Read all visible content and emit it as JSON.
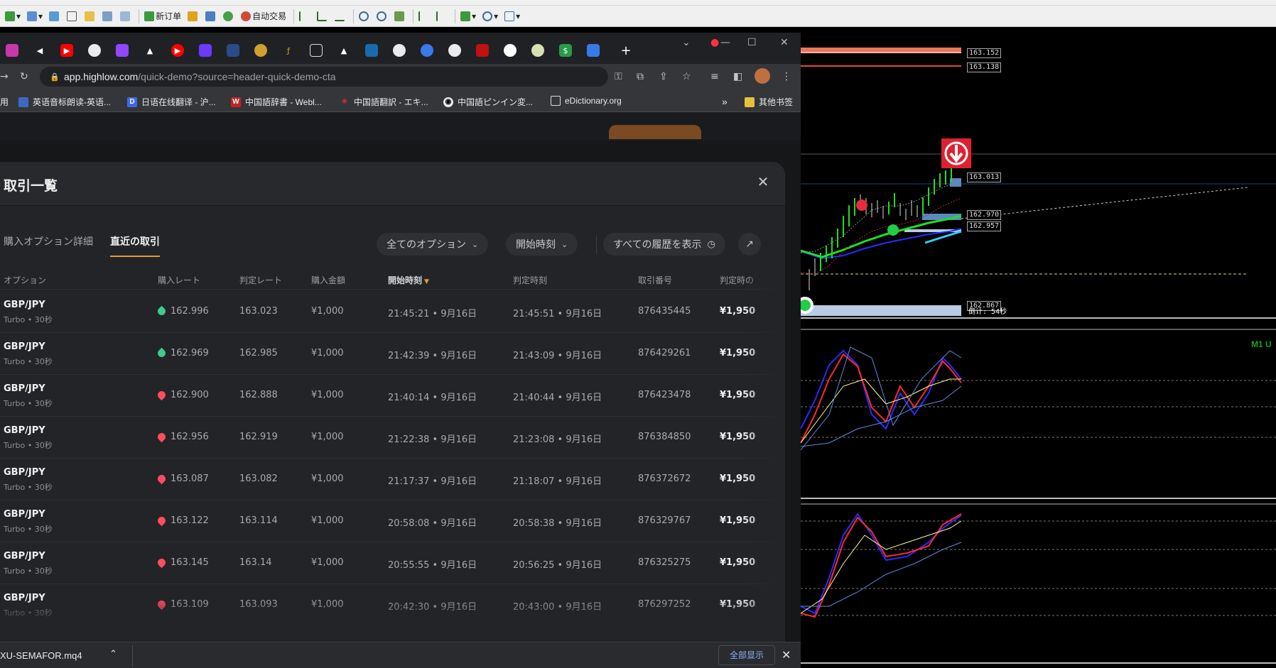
{
  "mt4": {
    "toolbar": {
      "new_order_label": "新订单",
      "auto_trade_label": "自动交易"
    }
  },
  "chart": {
    "price_labels": [
      "163.152",
      "163.138",
      "163.013",
      "162.970",
      "162.957",
      "162.867"
    ],
    "countdown_label": "倒计: 54秒",
    "indicator_label": "M1 U",
    "colors": {
      "background": "#000000",
      "fast_line": "#ff2a2a",
      "slow_line": "#2a2aff",
      "signal_line": "#ffff66",
      "band_line": "#5aa0ff"
    }
  },
  "browser": {
    "url_host": "app.highlow.com",
    "url_path": "/quick-demo?source=header-quick-demo-cta",
    "bookmarks": [
      "英语音标朗读-英语...",
      "日语在线翻译 - 沪...",
      "中国語辞書 - Webl...",
      "中国語翻訳 - エキ...",
      "中国語ピンイン変...",
      "eDictionary.org"
    ],
    "bookmarks_partial": "用",
    "other_bookmarks": "其他书签",
    "more_bookmarks": "»"
  },
  "modal": {
    "title": "取引一覧",
    "tabs": [
      "購入オプション詳細",
      "直近の取引"
    ],
    "active_tab": "直近の取引",
    "filter_options": "全てのオプション",
    "filter_start_time": "開始時刻",
    "show_history": "すべての履歴を表示",
    "columns": [
      "オプション",
      "購入レート",
      "判定レート",
      "購入金額",
      "開始時刻",
      "判定時刻",
      "取引番号",
      "判定時の"
    ],
    "rows": [
      {
        "pair": "GBP/JPY",
        "type": "Turbo • 30秒",
        "direction": "up",
        "buy_rate": "162.996",
        "judge_rate": "163.023",
        "amount": "¥1,000",
        "start": "21:45:21 • 9月16日",
        "end": "21:45:51 • 9月16日",
        "trade_id": "876435445",
        "payout": "¥1,950"
      },
      {
        "pair": "GBP/JPY",
        "type": "Turbo • 30秒",
        "direction": "up",
        "buy_rate": "162.969",
        "judge_rate": "162.985",
        "amount": "¥1,000",
        "start": "21:42:39 • 9月16日",
        "end": "21:43:09 • 9月16日",
        "trade_id": "876429261",
        "payout": "¥1,950"
      },
      {
        "pair": "GBP/JPY",
        "type": "Turbo • 30秒",
        "direction": "down",
        "buy_rate": "162.900",
        "judge_rate": "162.888",
        "amount": "¥1,000",
        "start": "21:40:14 • 9月16日",
        "end": "21:40:44 • 9月16日",
        "trade_id": "876423478",
        "payout": "¥1,950"
      },
      {
        "pair": "GBP/JPY",
        "type": "Turbo • 30秒",
        "direction": "down",
        "buy_rate": "162.956",
        "judge_rate": "162.919",
        "amount": "¥1,000",
        "start": "21:22:38 • 9月16日",
        "end": "21:23:08 • 9月16日",
        "trade_id": "876384850",
        "payout": "¥1,950"
      },
      {
        "pair": "GBP/JPY",
        "type": "Turbo • 30秒",
        "direction": "down",
        "buy_rate": "163.087",
        "judge_rate": "163.082",
        "amount": "¥1,000",
        "start": "21:17:37 • 9月16日",
        "end": "21:18:07 • 9月16日",
        "trade_id": "876372672",
        "payout": "¥1,950"
      },
      {
        "pair": "GBP/JPY",
        "type": "Turbo • 30秒",
        "direction": "down",
        "buy_rate": "163.122",
        "judge_rate": "163.114",
        "amount": "¥1,000",
        "start": "20:58:08 • 9月16日",
        "end": "20:58:38 • 9月16日",
        "trade_id": "876329767",
        "payout": "¥1,950"
      },
      {
        "pair": "GBP/JPY",
        "type": "Turbo • 30秒",
        "direction": "down",
        "buy_rate": "163.145",
        "judge_rate": "163.14",
        "amount": "¥1,000",
        "start": "20:55:55 • 9月16日",
        "end": "20:56:25 • 9月16日",
        "trade_id": "876325275",
        "payout": "¥1,950"
      },
      {
        "pair": "GBP/JPY",
        "type": "Turbo • 30秒",
        "direction": "down",
        "buy_rate": "163.109",
        "judge_rate": "163.093",
        "amount": "¥1,000",
        "start": "20:42:30 • 9月16日",
        "end": "20:43:00 • 9月16日",
        "trade_id": "876297252",
        "payout": "¥1,950"
      }
    ]
  },
  "download_bar": {
    "filename": "XU-SEMAFOR.mq4",
    "show_all": "全部显示"
  }
}
